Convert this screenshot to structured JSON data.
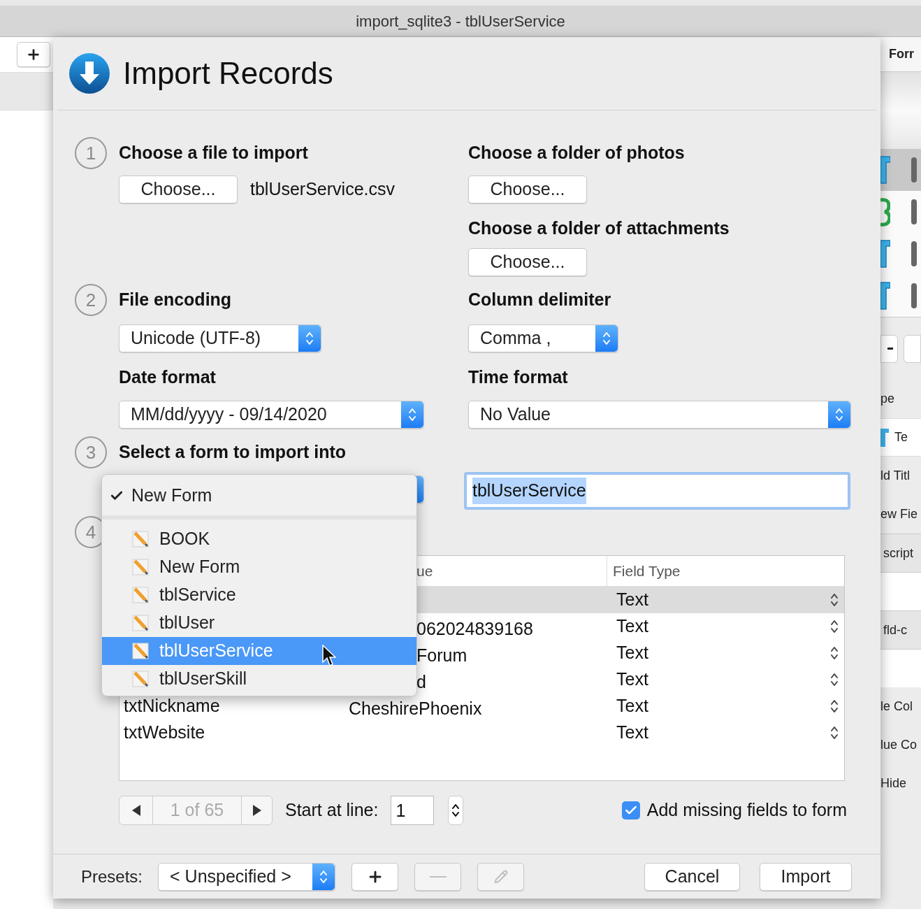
{
  "window": {
    "title": "import_sqlite3 - tblUserService"
  },
  "background_app": {
    "right_panel": [
      {
        "kind": "heading",
        "text": "Forr"
      },
      {
        "kind": "band"
      },
      {
        "kind": "text_type",
        "selected": true
      },
      {
        "kind": "number_type",
        "selected": false
      },
      {
        "kind": "text_type",
        "selected": false
      },
      {
        "kind": "text_type",
        "selected": false
      },
      {
        "kind": "buttons"
      },
      {
        "kind": "label",
        "text": "pe"
      },
      {
        "kind": "type_label",
        "text": "Te"
      },
      {
        "kind": "label",
        "text": "ld Titl"
      },
      {
        "kind": "label",
        "text": "ew Fie"
      },
      {
        "kind": "section",
        "text": "script"
      },
      {
        "kind": "section",
        "text": "fld-c"
      },
      {
        "kind": "label",
        "text": "le Col"
      },
      {
        "kind": "label",
        "text": "lue Co"
      },
      {
        "kind": "label",
        "text": "Hide"
      }
    ]
  },
  "dialog": {
    "title": "Import Records",
    "step_1": {
      "number": "1",
      "title": "Choose a file to import",
      "button": "Choose...",
      "file_name": "tblUserService.csv"
    },
    "photos": {
      "title": "Choose a folder of photos",
      "button": "Choose..."
    },
    "attachments": {
      "title": "Choose a folder of attachments",
      "button": "Choose..."
    },
    "step_2": {
      "number": "2",
      "title": "File encoding",
      "value": "Unicode (UTF-8)"
    },
    "column_delimiter": {
      "title": "Column delimiter",
      "value": "Comma ,"
    },
    "date_format": {
      "title": "Date format",
      "value": "MM/dd/yyyy - 09/14/2020"
    },
    "time_format": {
      "title": "Time format",
      "value": "No Value"
    },
    "step_3": {
      "number": "3",
      "title": "Select a form to import into"
    },
    "form_name_field": {
      "value": "tblUserService",
      "text_selected": true
    },
    "step_4": {
      "number": "4"
    },
    "field_table": {
      "columns": [
        {
          "label": "ue",
          "covered": true
        },
        {
          "label": "Field Type",
          "covered": false
        }
      ],
      "rows": [
        {
          "type": "Text",
          "selected": true,
          "covered": true
        },
        {
          "value": "062024839168",
          "type": "Text",
          "selected": false,
          "covered": true
        },
        {
          "value": "Forum",
          "type": "Text",
          "selected": false,
          "covered": true
        },
        {
          "value": "d",
          "type": "Text",
          "selected": false,
          "covered": true
        },
        {
          "field": "txtNickname",
          "value": "CheshirePhoenix",
          "type": "Text",
          "selected": false,
          "covered": false
        },
        {
          "field": "txtWebsite",
          "type": "Text",
          "selected": false
        }
      ]
    },
    "pager": {
      "label": "1 of 65",
      "disabled": true
    },
    "start_line": {
      "label": "Start at line:",
      "value": "1"
    },
    "add_missing": {
      "label": "Add missing fields to form",
      "checked": true
    },
    "footer": {
      "presets_label": "Presets:",
      "preset": "< Unspecified >",
      "add_disabled": false,
      "remove_disabled": true,
      "edit_disabled": true,
      "cancel": "Cancel",
      "import": "Import"
    },
    "form_menu": {
      "items": [
        {
          "kind": "current",
          "label": "New Form",
          "checked": true,
          "selected": false
        },
        {
          "kind": "form",
          "label": "BOOK",
          "checked": false,
          "selected": false
        },
        {
          "kind": "form",
          "label": "New Form",
          "checked": false,
          "selected": false
        },
        {
          "kind": "form",
          "label": "tblService",
          "checked": false,
          "selected": false
        },
        {
          "kind": "form",
          "label": "tblUser",
          "checked": false,
          "selected": false
        },
        {
          "kind": "form",
          "label": "tblUserService",
          "checked": false,
          "selected": true
        },
        {
          "kind": "form",
          "label": "tblUserSkill",
          "checked": false,
          "selected": false
        }
      ]
    }
  }
}
